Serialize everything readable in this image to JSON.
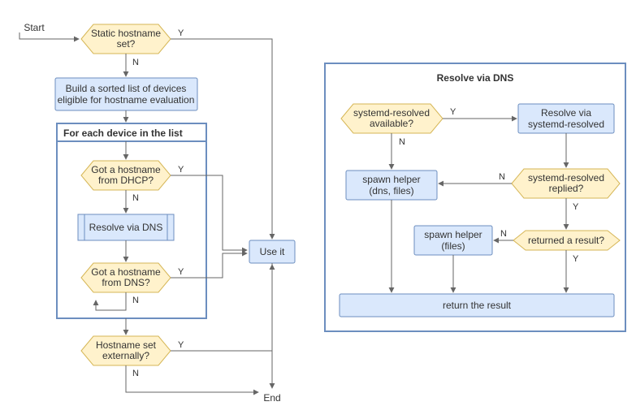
{
  "terminals": {
    "start": "Start",
    "end": "End"
  },
  "main": {
    "staticHostname": "Static hostname\nset?",
    "buildList": "Build a sorted list of devices\neligible for hostname evaluation",
    "loopTitle": "For each device in the list",
    "gotDhcp": "Got a hostname\nfrom DHCP?",
    "resolveDns": "Resolve via DNS",
    "gotDns": "Got a hostname\nfrom DNS?",
    "hostnameExt": "Hostname set\nexternally?",
    "useIt": "Use it"
  },
  "dnsBox": {
    "title": "Resolve via DNS",
    "resolvedAvail": "systemd-resolved\navailable?",
    "resolveVia": "Resolve via\nsystemd-resolved",
    "spawnDnsFiles": "spawn helper\n(dns, files)",
    "resolvedReplied": "systemd-resolved\nreplied?",
    "spawnFiles": "spawn helper\n(files)",
    "returnedResult": "returned a result?",
    "returnResult": "return the result"
  },
  "labels": {
    "yes": "Y",
    "no": "N"
  }
}
